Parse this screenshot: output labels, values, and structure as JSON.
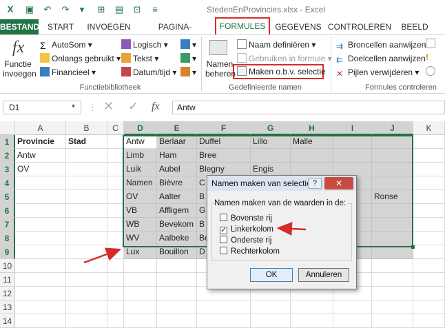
{
  "window": {
    "title": "StedenEnProvincies.xlsx - Excel"
  },
  "tabs": [
    "BESTAND",
    "START",
    "INVOEGEN",
    "PAGINA-INDELING",
    "FORMULES",
    "GEGEVENS",
    "CONTROLEREN",
    "BEELD"
  ],
  "ribbon": {
    "insert_function": {
      "line1": "Functie",
      "line2": "invoegen"
    },
    "autosum": "AutoSom",
    "recent": "Onlangs gebruikt",
    "financial": "Financieel",
    "logical": "Logisch",
    "text": "Tekst",
    "datetime": "Datum/tijd",
    "name_manager": {
      "line1": "Namen",
      "line2": "beheren"
    },
    "define_name": "Naam definiëren",
    "use_in_formula": "Gebruiken in formule",
    "create_from_selection": "Maken o.b.v. selectie",
    "trace_precedents": "Broncellen aanwijzen",
    "trace_dependents": "Doelcellen aanwijzen",
    "remove_arrows": "Pijlen verwijderen",
    "group_function_library": "Functiebibliotheek",
    "group_defined_names": "Gedefinieerde namen",
    "group_formula_auditing": "Formules controleren"
  },
  "formula_bar": {
    "name_box": "D1",
    "fx": "fx",
    "value": "Antw"
  },
  "columns": [
    "A",
    "B",
    "C",
    "D",
    "E",
    "F",
    "G",
    "H",
    "I",
    "J",
    "K"
  ],
  "rows": [
    "1",
    "2",
    "3",
    "4",
    "5",
    "6",
    "7",
    "8",
    "9",
    "10",
    "11",
    "12",
    "13",
    "14"
  ],
  "cells": {
    "A1": "Provincie",
    "B1": "Stad",
    "A2": "Antw",
    "A3": "OV",
    "D1": "Antw",
    "E1": "Berlaar",
    "F1": "Duffel",
    "G1": "Lillo",
    "H1": "Malle",
    "D2": "Limb",
    "E2": "Ham",
    "F2": "Bree",
    "D3": "Luik",
    "E3": "Aubel",
    "F3": "Blegny",
    "G3": "Engis",
    "D4": "Namen",
    "E4": "Bièvre",
    "F4": "C",
    "D5": "OV",
    "E5": "Aalter",
    "F5": "B",
    "J5": "Ronse",
    "D6": "VB",
    "E6": "Affligem",
    "F6": "G",
    "D7": "WB",
    "E7": "Bevekom",
    "F7": "B",
    "D8": "WV",
    "E8": "Aalbeke",
    "F8": "Be",
    "D9": "Lux",
    "E9": "Bouillon",
    "F9": "D"
  },
  "dialog": {
    "title": "Namen maken van selectie",
    "help": "?",
    "close": "✕",
    "group_label": "Namen maken van de waarden in de:",
    "options": [
      {
        "label": "Bovenste rij",
        "checked": false
      },
      {
        "label": "Linkerkolom",
        "checked": true
      },
      {
        "label": "Onderste rij",
        "checked": false
      },
      {
        "label": "Rechterkolom",
        "checked": false
      }
    ],
    "ok": "OK",
    "cancel": "Annuleren"
  },
  "colors": {
    "accent": "#217346",
    "highlight": "#d62b2b"
  }
}
